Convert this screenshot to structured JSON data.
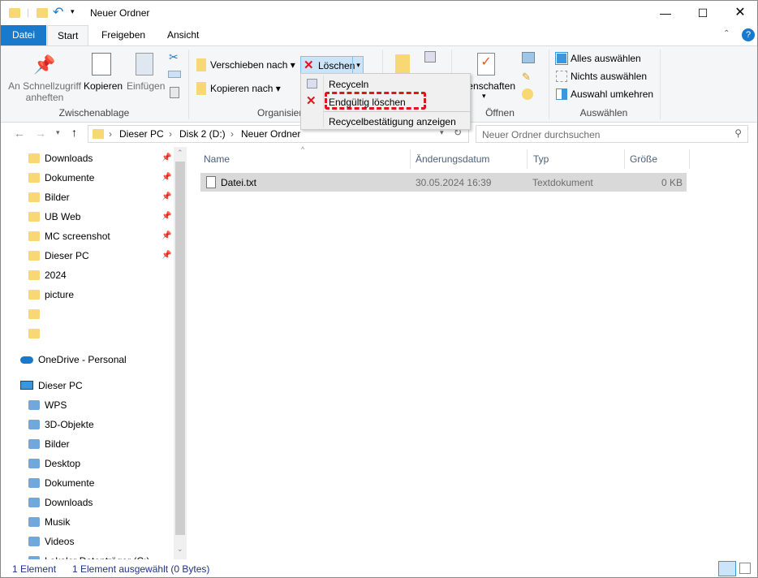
{
  "window": {
    "title": "Neuer Ordner"
  },
  "tabs": [
    "Datei",
    "Start",
    "Freigeben",
    "Ansicht"
  ],
  "ribbon": {
    "clipboard": {
      "pin": "An Schnellzugriff anheften",
      "copy": "Kopieren",
      "paste": "Einfügen",
      "label": "Zwischenablage"
    },
    "organize": {
      "move": "Verschieben nach",
      "copyto": "Kopieren nach",
      "delete": "Löschen",
      "label": "Organisieren"
    },
    "open": {
      "properties": "Eigenschaften",
      "label": "Öffnen"
    },
    "select": {
      "all": "Alles auswählen",
      "none": "Nichts auswählen",
      "invert": "Auswahl umkehren",
      "label": "Auswählen"
    }
  },
  "delete_menu": {
    "items": [
      "Recyceln",
      "Endgültig löschen",
      "Recycelbestätigung anzeigen"
    ]
  },
  "address": {
    "path": [
      "Dieser PC",
      "Disk 2 (D:)",
      "Neuer Ordner"
    ],
    "search_placeholder": "Neuer Ordner durchsuchen"
  },
  "nav": {
    "quick": [
      {
        "label": "Downloads",
        "pinned": true
      },
      {
        "label": "Dokumente",
        "pinned": true
      },
      {
        "label": "Bilder",
        "pinned": true
      },
      {
        "label": "UB Web",
        "pinned": true
      },
      {
        "label": "MC screenshot",
        "pinned": true
      },
      {
        "label": "Dieser PC",
        "pinned": true
      },
      {
        "label": "2024"
      },
      {
        "label": "picture"
      },
      {
        "label": ""
      },
      {
        "label": ""
      }
    ],
    "onedrive": "OneDrive - Personal",
    "thispc": "Dieser PC",
    "pc_items": [
      "WPS",
      "3D-Objekte",
      "Bilder",
      "Desktop",
      "Dokumente",
      "Downloads",
      "Musik",
      "Videos",
      "Lokaler Datenträger (C:)"
    ]
  },
  "columns": [
    "Name",
    "Änderungsdatum",
    "Typ",
    "Größe"
  ],
  "files": [
    {
      "name": "Datei.txt",
      "date": "30.05.2024 16:39",
      "type": "Textdokument",
      "size": "0 KB"
    }
  ],
  "status": {
    "count": "1 Element",
    "selected": "1 Element ausgewählt (0 Bytes)"
  }
}
